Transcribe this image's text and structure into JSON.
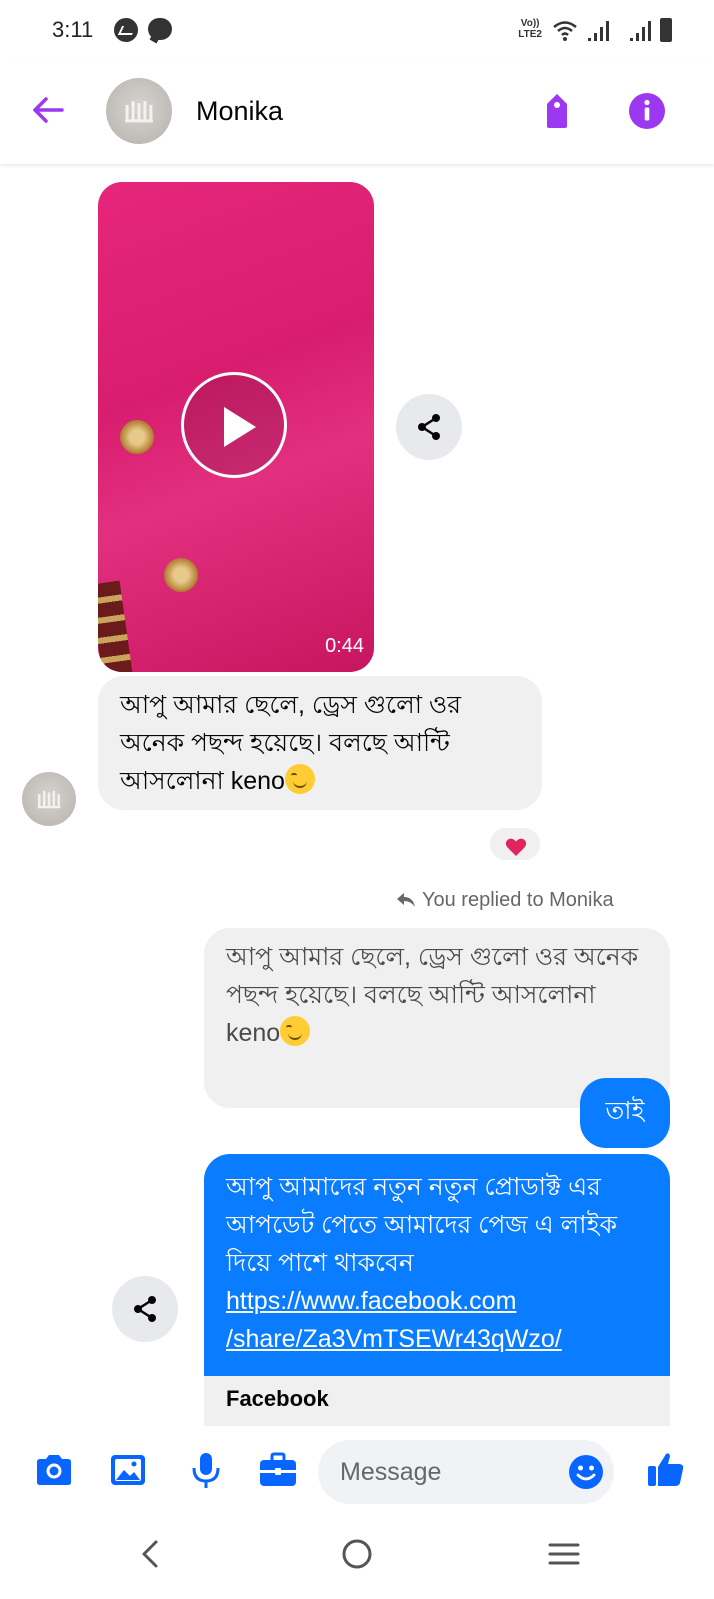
{
  "status_bar": {
    "time": "3:11",
    "network_label_1": "Vo))",
    "network_label_2": "LTE2"
  },
  "header": {
    "contact_name": "Monika"
  },
  "messages": {
    "video_duration": "0:44",
    "incoming_text": "আপু আমার ছেলে, ড্রেস গুলো ওর অনেক পছন্দ হয়েছে। বলছে আন্টি আসলোনা keno",
    "reaction": "heart",
    "replied_label": "You replied to Monika",
    "quoted_text": "আপু আমার ছেলে, ড্রেস গুলো ওর অনেক পছন্দ হয়েছে। বলছে আন্টি আসলোনা keno",
    "reply_text": "তাই",
    "promo_text": "আপু আমাদের নতুন নতুন প্রোডাক্ট এর আপডেট পেতে আমাদের পেজ এ লাইক দিয়ে পাশে থাকবেন",
    "promo_link_1": "https://www.facebook.com",
    "promo_link_2": "/share/Za3VmTSEWr43qWzo/",
    "preview_title": "Facebook"
  },
  "composer": {
    "placeholder": "Message"
  },
  "colors": {
    "accent_purple": "#9c38ef",
    "messenger_blue": "#0a7cff",
    "icon_blue": "#0866ff",
    "heart_red": "#e0245e"
  }
}
